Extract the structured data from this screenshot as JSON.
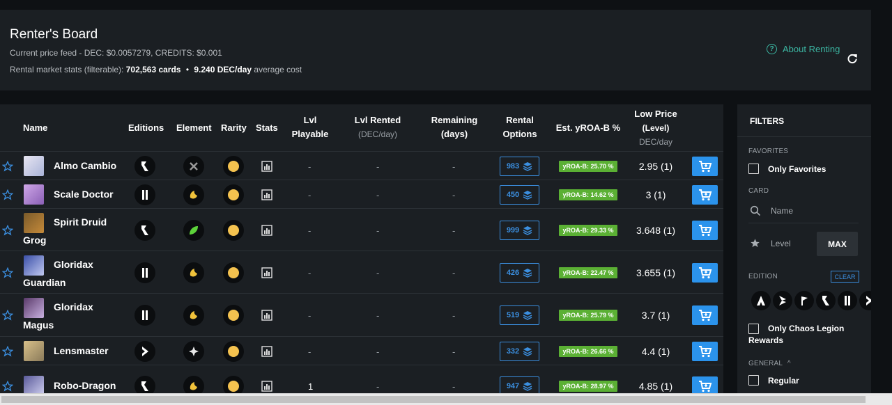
{
  "header": {
    "title": "Renter's Board",
    "price_feed": "Current price feed - DEC: $0.0057279, CREDITS: $0.001",
    "stats_prefix": "Rental market stats (filterable):",
    "stats_cards": "702,563 cards",
    "stats_bullet": "•",
    "stats_cost": "9.240 DEC/day",
    "stats_suffix": "average cost",
    "about_label": "About Renting",
    "about_icon": "?"
  },
  "columns": {
    "name": "Name",
    "editions": "Editions",
    "element": "Element",
    "rarity": "Rarity",
    "stats": "Stats",
    "lvl_playable_1": "Lvl",
    "lvl_playable_2": "Playable",
    "lvl_rented": "Lvl Rented",
    "lvl_rented_sub": "(DEC/day)",
    "remaining_1": "Remaining",
    "remaining_2": "(days)",
    "rental_1": "Rental",
    "rental_2": "Options",
    "yroa": "Est. yROA-B %",
    "low_price_1": "Low Price",
    "low_price_2": "(Level)",
    "low_price_sub": "DEC/day"
  },
  "rows": [
    {
      "name1": "Almo Cambio",
      "name2": "",
      "edition": "untamed",
      "element": "neutral",
      "lvl_playable": "-",
      "lvl_rented": "-",
      "remaining": "-",
      "options": "983",
      "yroa": "yROA-B: 25.70 %",
      "price": "2.95 (1)"
    },
    {
      "name1": "Scale Doctor",
      "name2": "",
      "edition": "chaos",
      "element": "earth",
      "lvl_playable": "-",
      "lvl_rented": "-",
      "remaining": "-",
      "options": "450",
      "yroa": "yROA-B: 14.62 %",
      "price": "3 (1)"
    },
    {
      "name1": "Spirit Druid",
      "name2": "Grog",
      "edition": "untamed",
      "element": "life",
      "lvl_playable": "-",
      "lvl_rented": "-",
      "remaining": "-",
      "options": "999",
      "yroa": "yROA-B: 29.33 %",
      "price": "3.648 (1)"
    },
    {
      "name1": "Gloridax",
      "name2": "Guardian",
      "edition": "chaos",
      "element": "earth",
      "lvl_playable": "-",
      "lvl_rented": "-",
      "remaining": "-",
      "options": "426",
      "yroa": "yROA-B: 22.47 %",
      "price": "3.655 (1)"
    },
    {
      "name1": "Gloridax",
      "name2": "Magus",
      "edition": "chaos",
      "element": "earth",
      "lvl_playable": "-",
      "lvl_rented": "-",
      "remaining": "-",
      "options": "519",
      "yroa": "yROA-B: 25.79 %",
      "price": "3.7 (1)"
    },
    {
      "name1": "Lensmaster",
      "name2": "",
      "edition": "reward",
      "element": "dragon",
      "lvl_playable": "-",
      "lvl_rented": "-",
      "remaining": "-",
      "options": "332",
      "yroa": "yROA-B: 26.66 %",
      "price": "4.4 (1)"
    },
    {
      "name1": "Robo-Dragon",
      "name2": "",
      "edition": "untamed",
      "element": "earth",
      "lvl_playable": "1",
      "lvl_rented": "-",
      "remaining": "-",
      "options": "947",
      "yroa": "yROA-B: 28.97 %",
      "price": "4.85 (1)"
    }
  ],
  "filters": {
    "title": "FILTERS",
    "favorites_label": "FAVORITES",
    "only_favorites": "Only Favorites",
    "card_label": "CARD",
    "name_placeholder": "Name",
    "level_placeholder": "Level",
    "max_label": "MAX",
    "edition_label": "EDITION",
    "clear_label": "CLEAR",
    "only_chaos": "Only Chaos Legion Rewards",
    "general_label": "GENERAL",
    "general_chevron": "^",
    "regular": "Regular"
  },
  "colors": {
    "accent_teal": "#3cb7a3",
    "accent_blue": "#2b93ec",
    "yroa_green": "#5bb034",
    "panel": "#1b1f23",
    "background": "#0e1114"
  }
}
